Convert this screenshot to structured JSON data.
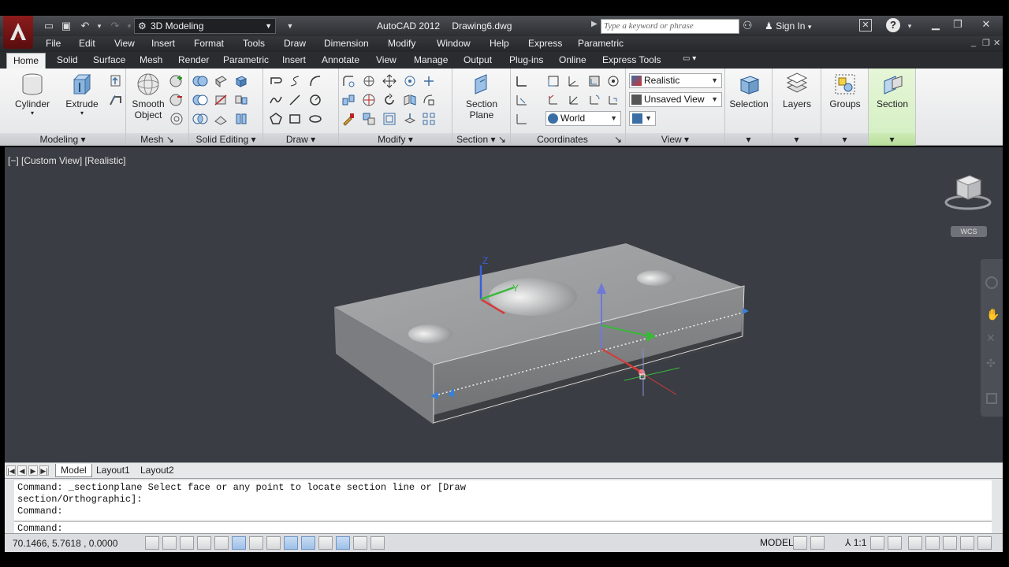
{
  "titlebar": {
    "workspace": "3D Modeling",
    "app_name": "AutoCAD 2012",
    "document": "Drawing6.dwg",
    "search_placeholder": "Type a keyword or phrase",
    "sign_in": "Sign In"
  },
  "menu": [
    "File",
    "Edit",
    "View",
    "Insert",
    "Format",
    "Tools",
    "Draw",
    "Dimension",
    "Modify",
    "Window",
    "Help",
    "Express",
    "Parametric"
  ],
  "ribbon_tabs": [
    "Home",
    "Solid",
    "Surface",
    "Mesh",
    "Render",
    "Parametric",
    "Insert",
    "Annotate",
    "View",
    "Manage",
    "Output",
    "Plug-ins",
    "Online",
    "Express Tools"
  ],
  "ribbon": {
    "cylinder": "Cylinder",
    "extrude": "Extrude",
    "smooth_object_1": "Smooth",
    "smooth_object_2": "Object",
    "section_plane_1": "Section",
    "section_plane_2": "Plane",
    "visual_style": "Realistic",
    "named_view": "Unsaved View",
    "ucs": "World",
    "selection": "Selection",
    "layers": "Layers",
    "groups": "Groups",
    "section": "Section",
    "panels": {
      "modeling": "Modeling",
      "mesh": "Mesh",
      "solid_editing": "Solid Editing",
      "draw": "Draw",
      "modify": "Modify",
      "section": "Section",
      "coordinates": "Coordinates",
      "view": "View"
    }
  },
  "viewport": {
    "label": "[−] [Custom View] [Realistic]",
    "wcs": "WCS",
    "axis_z": "Z",
    "axis_y": "Y"
  },
  "layout_tabs": [
    "Model",
    "Layout1",
    "Layout2"
  ],
  "command": {
    "line1": "Command: _sectionplane Select face or any point to locate section line or [Draw",
    "line2": "section/Orthographic]:",
    "line3": "Command:",
    "prompt": "Command:"
  },
  "status": {
    "coordinates": "70.1466,  5.7618 , 0.0000",
    "model": "MODEL",
    "scale": "1:1"
  },
  "colors": {
    "accent": "#3a6ea5",
    "app_logo": "#8c1c1c",
    "viewport_bg": "#3a3d43",
    "green_panel": "#d2eec0"
  }
}
